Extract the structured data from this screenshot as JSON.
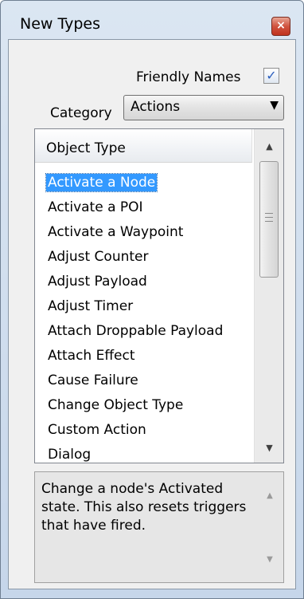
{
  "window": {
    "title": "New Types",
    "close_glyph": "×"
  },
  "options": {
    "friendly_names_label": "Friendly Names",
    "friendly_names_checked": true,
    "check_glyph": "✓",
    "category_label": "Category",
    "category_value": "Actions",
    "dropdown_glyph": "▼"
  },
  "list": {
    "header": "Object Type",
    "items": [
      "Activate a Node",
      "Activate a POI",
      "Activate a Waypoint",
      "Adjust Counter",
      "Adjust Payload",
      "Adjust Timer",
      "Attach Droppable Payload",
      "Attach Effect",
      "Cause Failure",
      "Change Object Type",
      "Custom Action",
      "Dialog"
    ],
    "selected_index": 0,
    "scroll_up_glyph": "▲",
    "scroll_down_glyph": "▼"
  },
  "description": {
    "text": "Change a node's Activated state. This also resets triggers that have fired.",
    "scroll_up_glyph": "▲",
    "scroll_down_glyph": "▼"
  }
}
